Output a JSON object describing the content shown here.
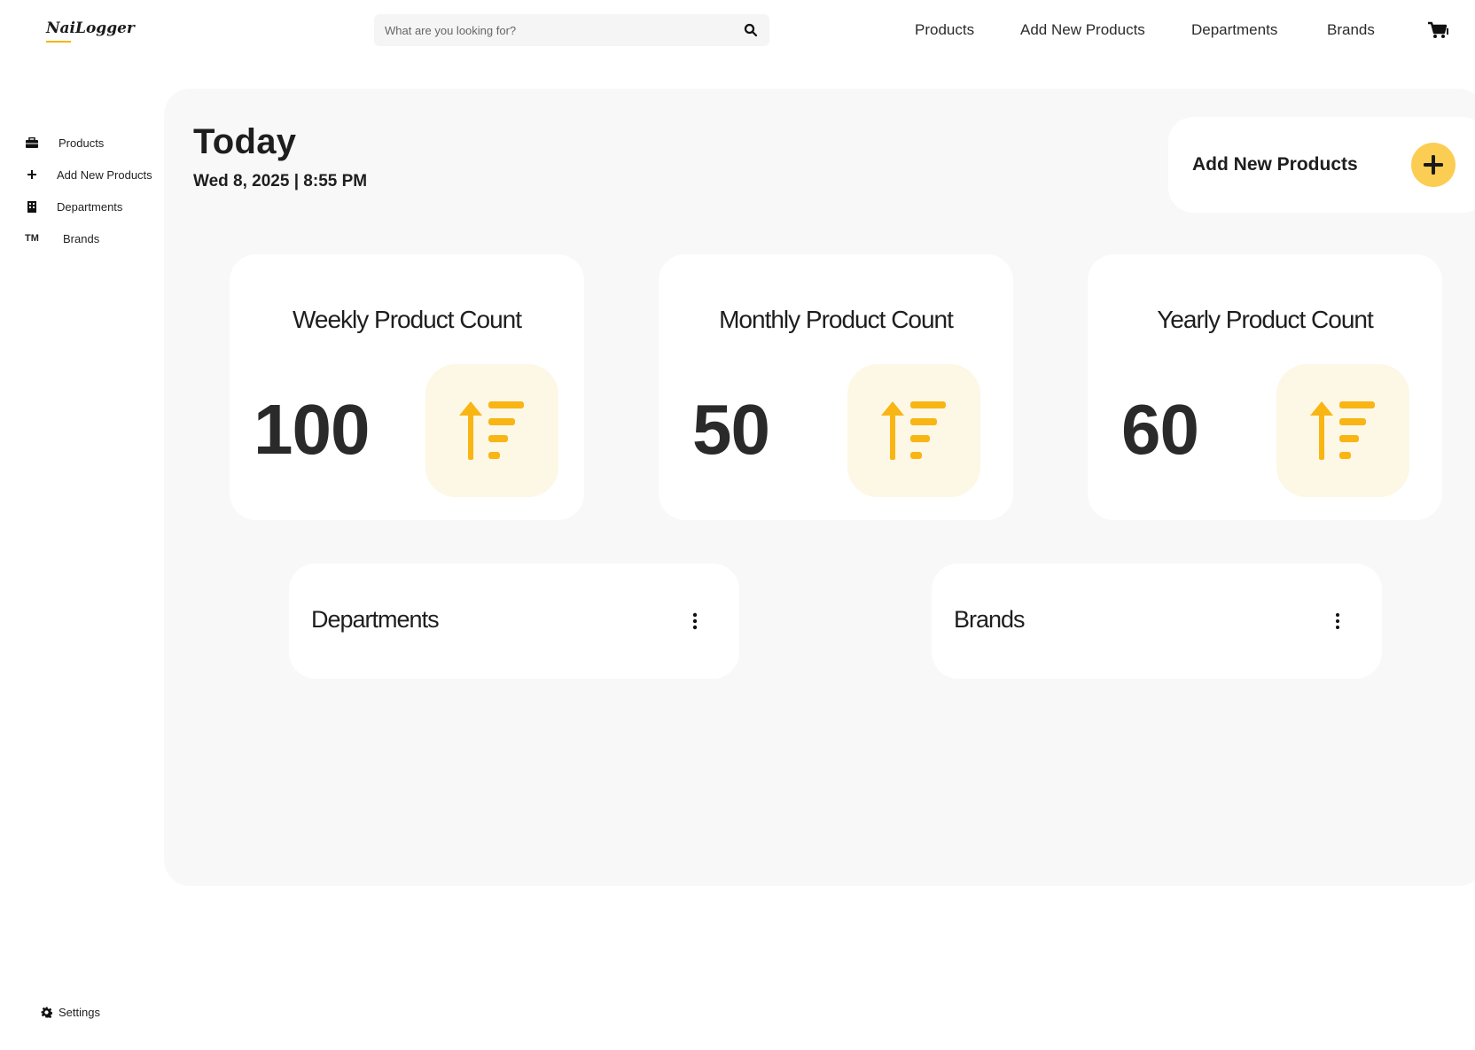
{
  "brand": {
    "logo": "NaiLogger",
    "accent": "#f5b400"
  },
  "search": {
    "placeholder": "What are you looking for?"
  },
  "topnav": [
    "Products",
    "Add New Products",
    "Departments",
    "Brands"
  ],
  "sidebar": {
    "items": [
      {
        "label": "Products",
        "icon": "toolbox-icon"
      },
      {
        "label": "Add New Products",
        "icon": "plus-icon"
      },
      {
        "label": "Departments",
        "icon": "building-icon"
      },
      {
        "label": "Brands",
        "icon": "trademark-icon",
        "icon_text": "TM"
      }
    ],
    "settings": "Settings"
  },
  "header": {
    "title": "Today",
    "date": "Wed 8, 2025 | 8:55 PM"
  },
  "add_card": {
    "label": "Add New Products",
    "button_color": "#fbcd52"
  },
  "stats": [
    {
      "title": "Weekly Product Count",
      "value": "100"
    },
    {
      "title": "Monthly Product Count",
      "value": "50"
    },
    {
      "title": "Yearly Product Count",
      "value": "60"
    }
  ],
  "lists": [
    {
      "title": "Departments"
    },
    {
      "title": "Brands"
    }
  ]
}
